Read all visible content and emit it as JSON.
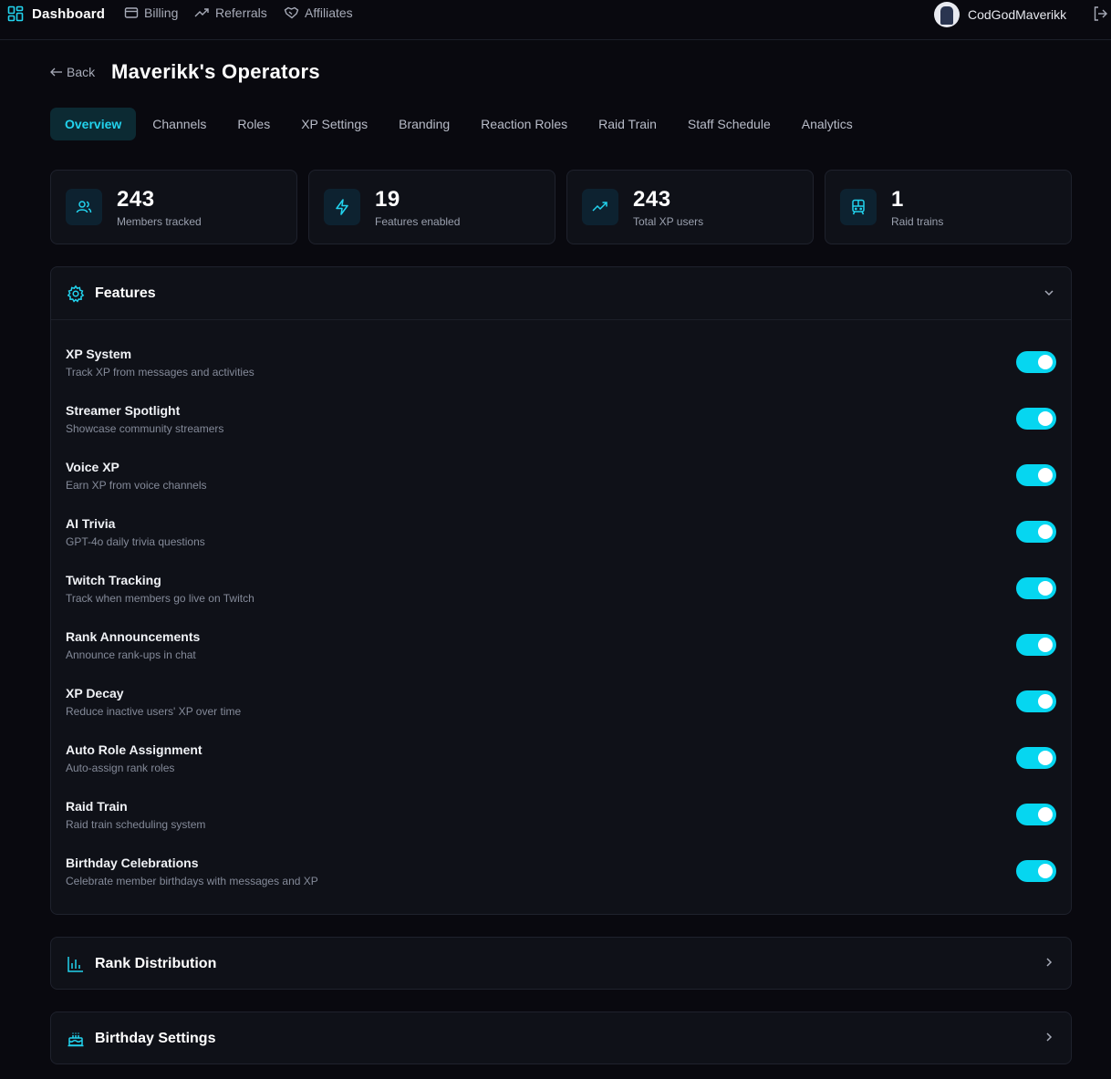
{
  "nav": {
    "brand": "Dashboard",
    "links": [
      {
        "label": "Billing",
        "icon": "card-icon"
      },
      {
        "label": "Referrals",
        "icon": "trending-icon"
      },
      {
        "label": "Affiliates",
        "icon": "handshake-icon"
      }
    ],
    "user": {
      "name": "CodGodMaverikk"
    }
  },
  "header": {
    "back_label": "Back",
    "title": "Maverikk's Operators"
  },
  "tabs": [
    "Overview",
    "Channels",
    "Roles",
    "XP Settings",
    "Branding",
    "Reaction Roles",
    "Raid Train",
    "Staff Schedule",
    "Analytics"
  ],
  "active_tab": "Overview",
  "stats": [
    {
      "value": "243",
      "label": "Members tracked",
      "icon": "users-icon"
    },
    {
      "value": "19",
      "label": "Features enabled",
      "icon": "lightning-icon"
    },
    {
      "value": "243",
      "label": "Total XP users",
      "icon": "trending-up-icon"
    },
    {
      "value": "1",
      "label": "Raid trains",
      "icon": "train-icon"
    }
  ],
  "features_panel": {
    "title": "Features",
    "items": [
      {
        "name": "XP System",
        "desc": "Track XP from messages and activities",
        "enabled": true
      },
      {
        "name": "Streamer Spotlight",
        "desc": "Showcase community streamers",
        "enabled": true
      },
      {
        "name": "Voice XP",
        "desc": "Earn XP from voice channels",
        "enabled": true
      },
      {
        "name": "AI Trivia",
        "desc": "GPT-4o daily trivia questions",
        "enabled": true
      },
      {
        "name": "Twitch Tracking",
        "desc": "Track when members go live on Twitch",
        "enabled": true
      },
      {
        "name": "Rank Announcements",
        "desc": "Announce rank-ups in chat",
        "enabled": true
      },
      {
        "name": "XP Decay",
        "desc": "Reduce inactive users' XP over time",
        "enabled": true
      },
      {
        "name": "Auto Role Assignment",
        "desc": "Auto-assign rank roles",
        "enabled": true
      },
      {
        "name": "Raid Train",
        "desc": "Raid train scheduling system",
        "enabled": true
      },
      {
        "name": "Birthday Celebrations",
        "desc": "Celebrate member birthdays with messages and XP",
        "enabled": true
      }
    ]
  },
  "rank_panel": {
    "title": "Rank Distribution"
  },
  "birthday_panel": {
    "title": "Birthday Settings"
  },
  "colors": {
    "accent": "#22d3ee",
    "background": "#09090f",
    "card": "#0f1118"
  }
}
